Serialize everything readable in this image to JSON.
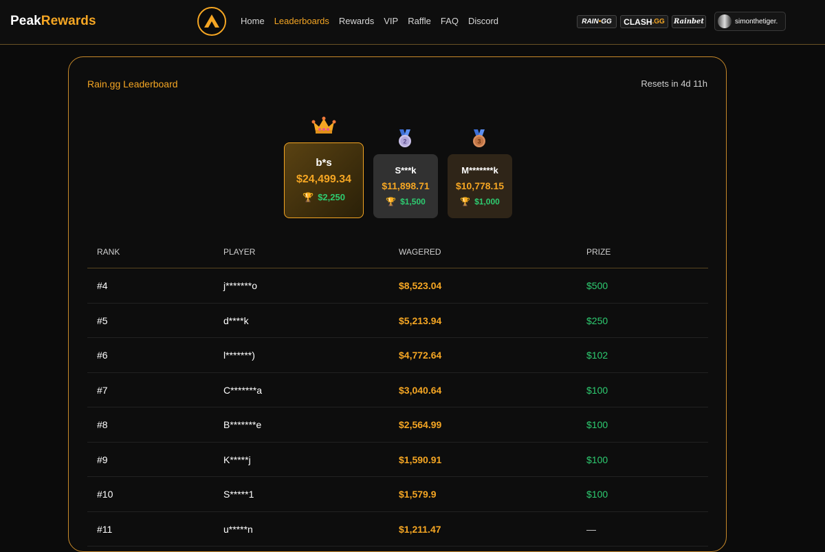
{
  "header": {
    "brand_part1": "Peak",
    "brand_part2": "Rewards",
    "nav": [
      "Home",
      "Leaderboards",
      "Rewards",
      "VIP",
      "Raffle",
      "FAQ",
      "Discord"
    ],
    "active_nav": "Leaderboards",
    "partners": {
      "rain_main": "RAIN",
      "rain_suffix": "GG",
      "clash_main": "CLASH",
      "clash_suffix": ".GG",
      "rainbet": "Rainbet"
    },
    "username": "simonthetiger."
  },
  "leaderboard": {
    "title": "Rain.gg Leaderboard",
    "reset_text": "Resets in 4d 11h",
    "podium": [
      {
        "place": 1,
        "name": "b*s",
        "wagered": "$24,499.34",
        "prize": "$2,250"
      },
      {
        "place": 2,
        "name": "S***k",
        "wagered": "$11,898.71",
        "prize": "$1,500"
      },
      {
        "place": 3,
        "name": "M*******k",
        "wagered": "$10,778.15",
        "prize": "$1,000"
      }
    ],
    "medal_labels": {
      "second": "2",
      "third": "3"
    },
    "columns": {
      "rank": "RANK",
      "player": "PLAYER",
      "wagered": "WAGERED",
      "prize": "PRIZE"
    },
    "rows": [
      {
        "rank": "#4",
        "player": "j*******o",
        "wagered": "$8,523.04",
        "prize": "$500"
      },
      {
        "rank": "#5",
        "player": "d****k",
        "wagered": "$5,213.94",
        "prize": "$250"
      },
      {
        "rank": "#6",
        "player": "l*******)",
        "wagered": "$4,772.64",
        "prize": "$102"
      },
      {
        "rank": "#7",
        "player": "C*******a",
        "wagered": "$3,040.64",
        "prize": "$100"
      },
      {
        "rank": "#8",
        "player": "B*******e",
        "wagered": "$2,564.99",
        "prize": "$100"
      },
      {
        "rank": "#9",
        "player": "K*****j",
        "wagered": "$1,590.91",
        "prize": "$100"
      },
      {
        "rank": "#10",
        "player": "S*****1",
        "wagered": "$1,579.9",
        "prize": "$100"
      },
      {
        "rank": "#11",
        "player": "u*****n",
        "wagered": "$1,211.47",
        "prize": "—"
      }
    ]
  },
  "colors": {
    "accent": "#f5a623",
    "prize_green": "#2ecc71",
    "background": "#0b0b0b"
  }
}
